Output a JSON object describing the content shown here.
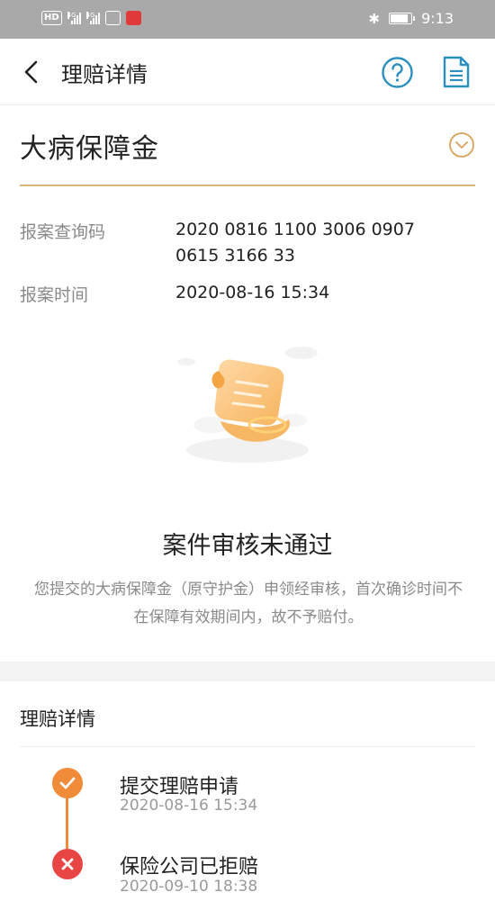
{
  "status_bar": {
    "hd_label": "HD",
    "network_1": "4G",
    "network_2": "4G",
    "time": "9:13",
    "battery_level_percent": 90
  },
  "nav": {
    "title": "理赔详情",
    "back_icon": "chevron-left-icon",
    "help_icon": "question-circle-icon",
    "doc_icon": "document-icon",
    "accent_color": "#2a8fbf"
  },
  "claim": {
    "product_title": "大病保障金",
    "expand_icon": "chevron-down-circle-icon",
    "gold_color": "#d9b777",
    "query_code_label": "报案查询码",
    "query_code_value": "2020 0816 1100 3006 0907 0615 3166 33",
    "report_time_label": "报案时间",
    "report_time_value": "2020-08-16 15:34"
  },
  "result": {
    "illustration": "scroll-document-illustration",
    "title": "案件审核未通过",
    "description": "您提交的大病保障金（原守护金）申领经审核，首次确诊时间不在保障有效期间内，故不予赔付。"
  },
  "details": {
    "section_title": "理赔详情",
    "steps": [
      {
        "title": "提交理赔申请",
        "time": "2020-08-16 15:34",
        "icon": "check-icon",
        "color": "#f08b3a"
      },
      {
        "title": "保险公司已拒赔",
        "time": "2020-09-10 18:38",
        "icon": "close-icon",
        "color": "#e84545"
      }
    ]
  }
}
